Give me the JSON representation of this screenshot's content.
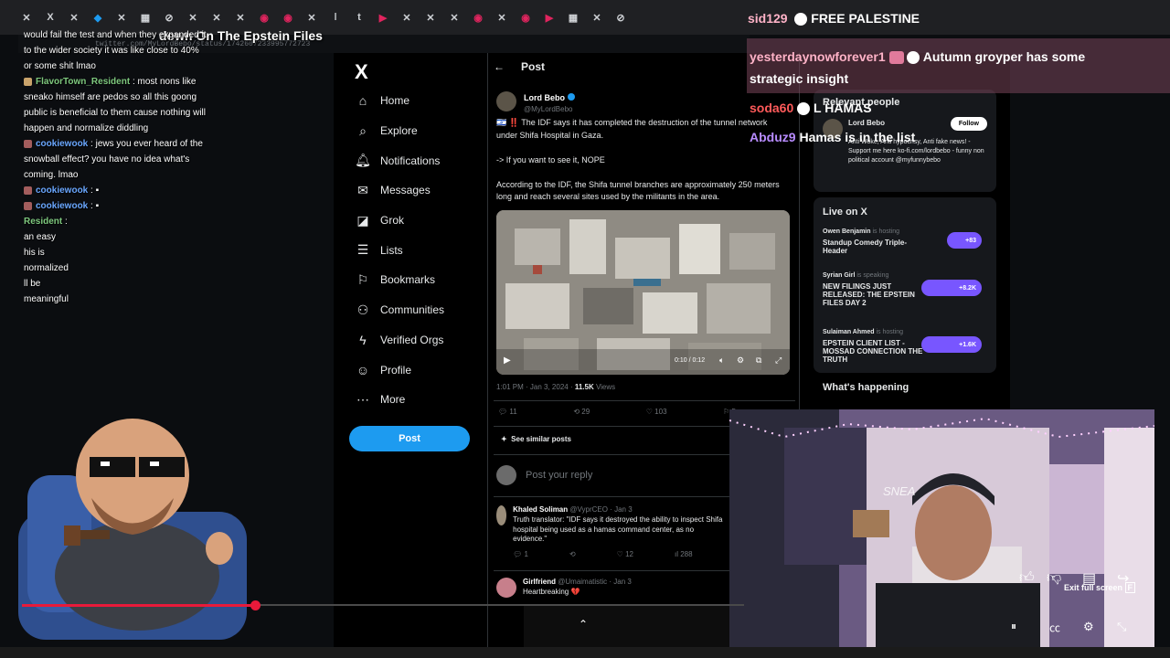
{
  "browser": {
    "video_title": "down On The Epstein Files",
    "url": "twitter.com/MyLordBebo/status/1742607233995772723"
  },
  "overlay": {
    "top_name": "sid129",
    "top_message": "FREE PALESTINE",
    "msg1_name": "yesterdaynowforever1",
    "msg1_text": "Autumn groyper has some strategic insight",
    "msg2_name": "soda60",
    "msg2_text": "L HAMAS",
    "msg3_name": "Abduz9",
    "msg3_text": "Hamas is in the list"
  },
  "chat": [
    {
      "user": "",
      "text": "would fail the test and when they expanded it to the wider society it was like close to 40% or some shit lmao"
    },
    {
      "user": "FlavorTown_Resident",
      "text": "most nons like sneako himself are pedos so all this goong public is beneficial to them cause nothing will happen and normalize diddling"
    },
    {
      "user": "cookiewook",
      "text": "jews you ever heard of the snowball effect? you have no idea what's coming. lmao"
    },
    {
      "user": "cookiewook",
      "text": ""
    },
    {
      "user": "cookiewook",
      "text": ""
    },
    {
      "user": "Resident",
      "text": ""
    }
  ],
  "chat_tail": [
    "an easy",
    "his is",
    "normalized",
    "ll be",
    "meaningful"
  ],
  "x": {
    "logo": "X",
    "nav": [
      {
        "label": "Home",
        "icon": "home-icon"
      },
      {
        "label": "Explore",
        "icon": "search-icon"
      },
      {
        "label": "Notifications",
        "icon": "bell-icon"
      },
      {
        "label": "Messages",
        "icon": "mail-icon"
      },
      {
        "label": "Grok",
        "icon": "grok-icon"
      },
      {
        "label": "Lists",
        "icon": "list-icon"
      },
      {
        "label": "Bookmarks",
        "icon": "bookmark-icon"
      },
      {
        "label": "Communities",
        "icon": "people-icon"
      },
      {
        "label": "Verified Orgs",
        "icon": "lightning-icon"
      },
      {
        "label": "Profile",
        "icon": "person-icon"
      },
      {
        "label": "More",
        "icon": "more-icon"
      }
    ],
    "post_button": "Post",
    "header": "Post",
    "author_name": "Lord Bebo",
    "author_handle": "@MyLordBebo",
    "post_text": "🇮🇱 ‼️ The IDF says it has completed the destruction of the tunnel network under Shifa Hospital in Gaza.\n\n-> If you want to see it, NOPE\n\nAccording to the IDF, the Shifa tunnel branches are approximately 250 meters long and reach several sites used by the militants in the area.",
    "video_time": "0:10 / 0:12",
    "meta_time": "1:01 PM · Jan 3, 2024 · ",
    "meta_views": "11.5K",
    "meta_views_label": " Views",
    "replies": "11",
    "reposts": "29",
    "likes": "103",
    "bookmarks": "5",
    "see_similar": "See similar posts",
    "reply_placeholder": "Post your reply",
    "reply1_name": "Khaled Soliman",
    "reply1_handle": "@VyprCEO · Jan 3",
    "reply1_text": "Truth translator: \"IDF says it destroyed the ability to inspect Shifa hospital being used as a hamas command center, as no evidence.\"",
    "reply1_replies": "1",
    "reply1_likes": "12",
    "reply1_views": "288",
    "reply2_name": "Girlfriend",
    "reply2_handle": "@Umaimatistic · Jan 3",
    "reply2_text": "Heartbreaking 💔"
  },
  "right": {
    "relevant_title": "Relevant people",
    "person_name": "Lord Bebo",
    "follow": "Follow",
    "person_bio": "Anti Woke, Anti hypocrisy, Anti fake news! - Support me here ko-fi.com/lordbebo - funny non political account @myfunnybebo",
    "live_title": "Live on X",
    "spaces": [
      {
        "host": "Owen Benjamin",
        "status": "is hosting",
        "title": "Standup Comedy Triple-Header",
        "count": "+83"
      },
      {
        "host": "Syrian Girl",
        "status": "is speaking",
        "title": "NEW FILINGS JUST RELEASED: THE EPSTEIN FILES DAY 2",
        "count": "+8.2K"
      },
      {
        "host": "Sulaiman Ahmed",
        "status": "is hosting",
        "title": "EPSTEIN CLIENT LIST - MOSSAD CONNECTION THE TRUTH",
        "count": "+1.6K"
      }
    ],
    "whats_happening": "What's happening"
  },
  "player": {
    "exit_full_screen": "Exit full screen",
    "exit_key": "F"
  },
  "colors": {
    "accent": "#1d9bf0",
    "progress": "#e81a3a"
  }
}
